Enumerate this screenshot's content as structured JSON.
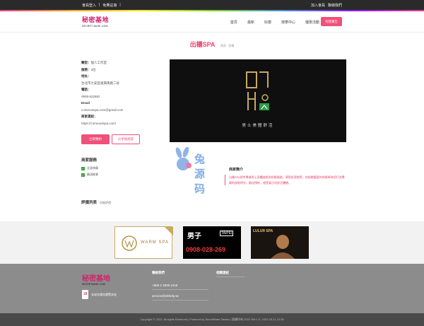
{
  "topbar": {
    "login": "會員登入",
    "register": "免費註冊",
    "sep": "|",
    "right_links": [
      "加入會員",
      "聯絡我們"
    ]
  },
  "nav": {
    "logo_text": "秘密基地",
    "logo_sub": "SECRET BASE.COM",
    "links": [
      "首頁",
      "最新",
      "好康",
      "按摩中心",
      "優惠活動"
    ],
    "cta": "刊登廣告"
  },
  "page": {
    "title": "出櫃SPA",
    "breadcrumb": "首頁 · 詳情"
  },
  "info": {
    "items": [
      {
        "k": "類型：",
        "v": "個人工作室"
      },
      {
        "k": "服務：",
        "v": "3位"
      },
      {
        "k": "地址：",
        "v": "台北市大安區復興南路二段"
      },
      {
        "k": "電話：",
        "v": "0906-522852"
      },
      {
        "k": "Email",
        "v": "comeoutspa.com@gmail.com"
      },
      {
        "k": "商家連結：",
        "v": "https://comeoutspa.com/"
      }
    ]
  },
  "buttons": {
    "book": "立即預約",
    "share": "分享給朋友"
  },
  "services": {
    "title": "商家服務",
    "items": [
      "全身按摩",
      "精油推拿"
    ]
  },
  "rating": {
    "title": "評價列表",
    "sub": "尚無評價"
  },
  "hero": {
    "tagline": "男士美體舒活"
  },
  "watermark": {
    "text": "兔源码"
  },
  "intro": {
    "title": "商家簡介",
    "text": "出櫃SPA提供專業男士身體放鬆與舒壓服務，環境舒適隱密，由經驗豐富的按摩師為您打造專屬的放鬆時光。歡迎預約，感受真正的舒活體驗。"
  },
  "banners": {
    "warm": "WARM SPA",
    "men": "男子",
    "men_sub": "TAIPEI",
    "men_phone": "0908-028-269",
    "lulur": "LULUR SPA"
  },
  "footer": {
    "logo_text": "秘密基地",
    "logo_sub": "SECRETBASE.COM",
    "promo": "未成年請勿瀏覽本站",
    "contact_title": "聯絡我們",
    "phone": "+886 2 2839 1618",
    "email": "service@sbhelp.tw",
    "links_title": "相關連結"
  },
  "copyright": "Copyright © 2022. All rights Reserved | Powered by SecretBase.Taiwan | 版權所有 2022 SW 1.0, 2022-03-11 12:35"
}
